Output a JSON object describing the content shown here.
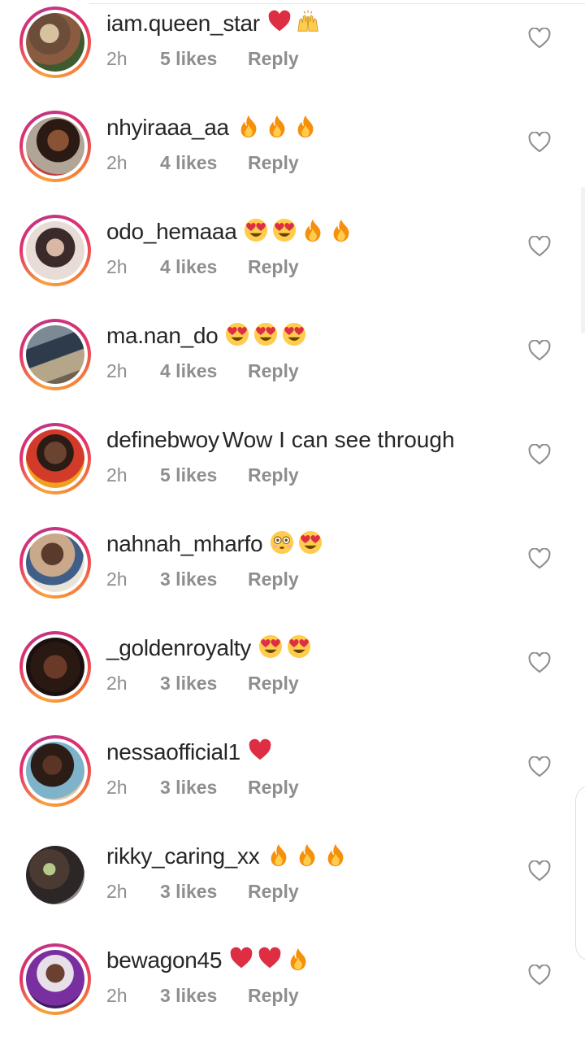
{
  "reply_label": "Reply",
  "colors": {
    "username": "#262626",
    "meta": "#8e8e8e",
    "ring_start": "#f9a23a",
    "ring_end": "#e1306c"
  },
  "comments": [
    {
      "username": "iam.queen_star",
      "text": "",
      "emojis": [
        "heart",
        "raised-hands"
      ],
      "time": "2h",
      "likes": "5 likes",
      "reply": "Reply",
      "story_ring": true
    },
    {
      "username": "nhyiraaa_aa",
      "text": "",
      "emojis": [
        "fire",
        "fire",
        "fire"
      ],
      "time": "2h",
      "likes": "4 likes",
      "reply": "Reply",
      "story_ring": true
    },
    {
      "username": "odo_hemaaa",
      "text": "",
      "emojis": [
        "heart-eyes",
        "heart-eyes",
        "fire",
        "fire"
      ],
      "time": "2h",
      "likes": "4 likes",
      "reply": "Reply",
      "story_ring": true
    },
    {
      "username": "ma.nan_do",
      "text": "",
      "emojis": [
        "heart-eyes",
        "heart-eyes",
        "heart-eyes"
      ],
      "time": "2h",
      "likes": "4 likes",
      "reply": "Reply",
      "story_ring": true
    },
    {
      "username": "definebwoy",
      "text": "Wow I can see through",
      "emojis": [],
      "time": "2h",
      "likes": "5 likes",
      "reply": "Reply",
      "story_ring": true
    },
    {
      "username": "nahnah_mharfo",
      "text": "",
      "emojis": [
        "flushed",
        "heart-eyes"
      ],
      "time": "2h",
      "likes": "3 likes",
      "reply": "Reply",
      "story_ring": true
    },
    {
      "username": "_goldenroyalty",
      "text": "",
      "emojis": [
        "heart-eyes",
        "heart-eyes"
      ],
      "time": "2h",
      "likes": "3 likes",
      "reply": "Reply",
      "story_ring": true
    },
    {
      "username": "nessaofficial1",
      "text": "",
      "emojis": [
        "heart"
      ],
      "time": "2h",
      "likes": "3 likes",
      "reply": "Reply",
      "story_ring": true
    },
    {
      "username": "rikky_caring_xx",
      "text": "",
      "emojis": [
        "fire",
        "fire",
        "fire"
      ],
      "time": "2h",
      "likes": "3 likes",
      "reply": "Reply",
      "story_ring": false
    },
    {
      "username": "bewagon45",
      "text": "",
      "emojis": [
        "heart",
        "heart",
        "fire"
      ],
      "time": "2h",
      "likes": "3 likes",
      "reply": "Reply",
      "story_ring": true
    }
  ]
}
